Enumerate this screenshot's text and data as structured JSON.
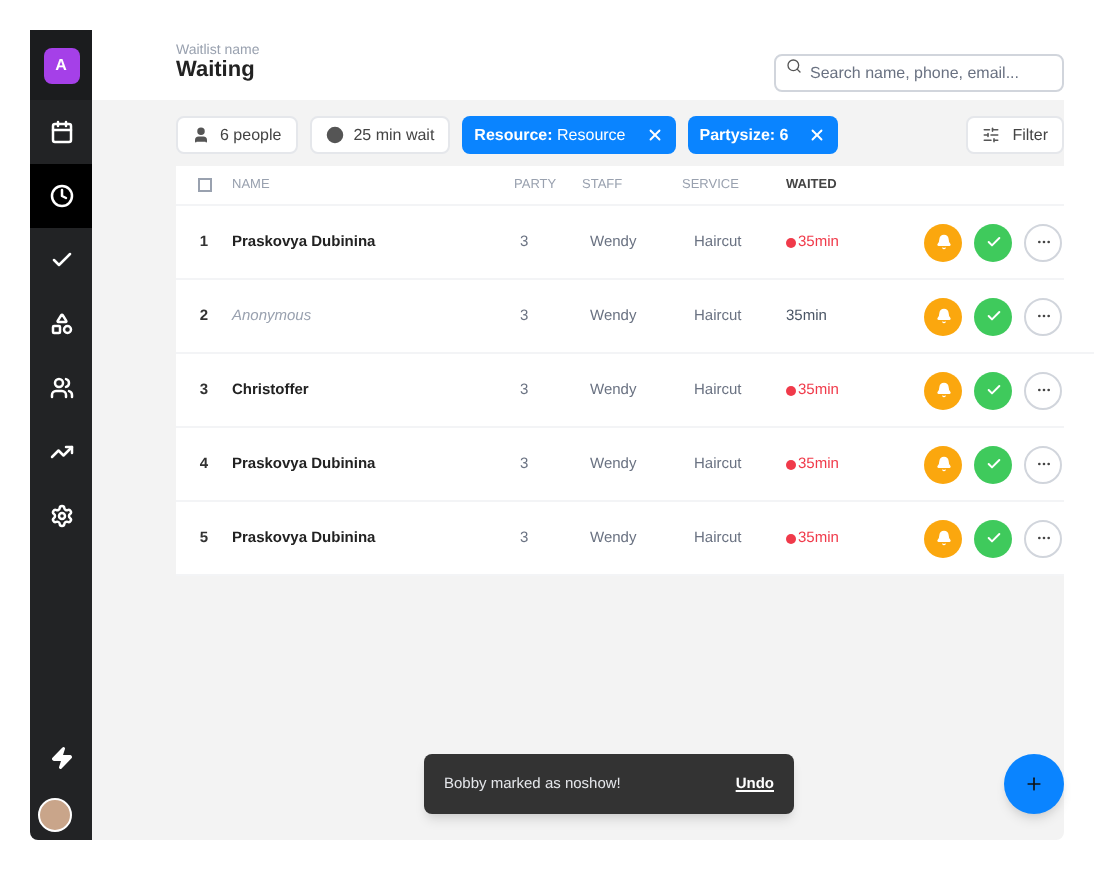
{
  "sidebar": {
    "logo": "A",
    "items": [
      {
        "selected": false
      },
      {
        "selected": true
      },
      {
        "selected": false
      },
      {
        "selected": false
      },
      {
        "selected": false
      },
      {
        "selected": false
      },
      {
        "selected": false
      }
    ]
  },
  "header": {
    "subtitle": "Waitlist name",
    "title": "Waiting",
    "search": {
      "placeholder": "Search name, phone, email..."
    }
  },
  "toolbar": {
    "stats": [
      {
        "label": "6 people"
      },
      {
        "label": "25 min wait"
      }
    ],
    "filters": [
      {
        "key": "Resource:",
        "value": "Resource"
      },
      {
        "key": "Partysize: 6"
      }
    ],
    "filter_button": "Filter"
  },
  "table": {
    "select_all": {
      "checked": false
    },
    "columns": [
      {
        "label": "NAME",
        "sorted": false
      },
      {
        "label": "PARTY",
        "sorted": false
      },
      {
        "label": "STAFF",
        "sorted": false
      },
      {
        "label": "SERVICE",
        "sorted": false
      },
      {
        "label": "WAITED",
        "sorted": true
      }
    ],
    "rows": [
      {
        "number": "1",
        "name": "Praskovya Dubinina",
        "anonymous": false,
        "party": "3",
        "staff": "Wendy",
        "service": "Haircut",
        "waited": "35min",
        "overdue": true
      },
      {
        "number": "2",
        "name": "Anonymous",
        "anonymous": true,
        "party": "3",
        "staff": "Wendy",
        "service": "Haircut",
        "waited": "35min",
        "overdue": false
      },
      {
        "number": "3",
        "name": "Christoffer",
        "anonymous": false,
        "party": "3",
        "staff": "Wendy",
        "service": "Haircut",
        "waited": "35min",
        "overdue": true
      },
      {
        "number": "4",
        "name": "Praskovya Dubinina",
        "anonymous": false,
        "party": "3",
        "staff": "Wendy",
        "service": "Haircut",
        "waited": "35min",
        "overdue": true
      },
      {
        "number": "5",
        "name": "Praskovya Dubinina",
        "anonymous": false,
        "party": "3",
        "staff": "Wendy",
        "service": "Haircut",
        "waited": "35min",
        "overdue": true
      }
    ]
  },
  "toast": {
    "message": "Bobby marked as noshow!",
    "action": "Undo"
  }
}
